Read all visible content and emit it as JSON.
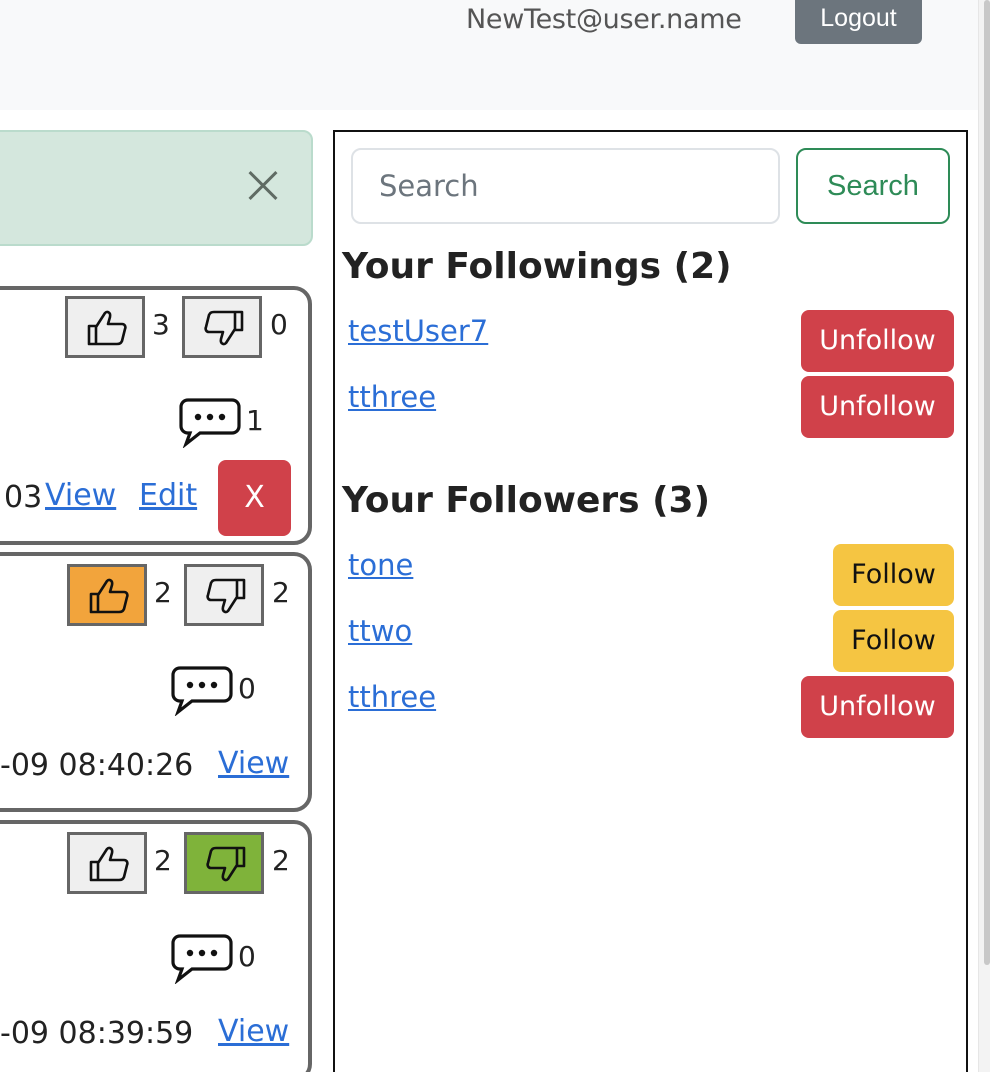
{
  "header": {
    "username": "NewTest@user.name",
    "logout_label": "Logout"
  },
  "alert": {
    "close_icon": "close-icon"
  },
  "posts": [
    {
      "likes": "3",
      "dislikes": "0",
      "comments": "1",
      "timestamp_fragment": "03",
      "view_label": "View",
      "edit_label": "Edit",
      "delete_label": "X",
      "like_state": "none",
      "dislike_state": "none"
    },
    {
      "likes": "2",
      "dislikes": "2",
      "comments": "0",
      "timestamp_fragment": "-09 08:40:26",
      "view_label": "View",
      "like_state": "active",
      "dislike_state": "none"
    },
    {
      "likes": "2",
      "dislikes": "2",
      "comments": "0",
      "timestamp_fragment": "-09 08:39:59",
      "view_label": "View",
      "like_state": "none",
      "dislike_state": "active"
    }
  ],
  "sidebar": {
    "search_placeholder": "Search",
    "search_button_label": "Search",
    "followings_title": "Your Followings (2)",
    "followings": [
      {
        "name": "testUser7",
        "action": "Unfollow"
      },
      {
        "name": "tthree",
        "action": "Unfollow"
      }
    ],
    "followers_title": "Your Followers (3)",
    "followers": [
      {
        "name": "tone",
        "action": "Follow"
      },
      {
        "name": "ttwo",
        "action": "Follow"
      },
      {
        "name": "tthree",
        "action": "Unfollow"
      }
    ]
  },
  "colors": {
    "like_active": "#f2a43c",
    "dislike_active": "#7fb33a",
    "danger": "#d0414a",
    "warning": "#f5c542",
    "success": "#2e8b57",
    "link": "#2b6ed6"
  }
}
